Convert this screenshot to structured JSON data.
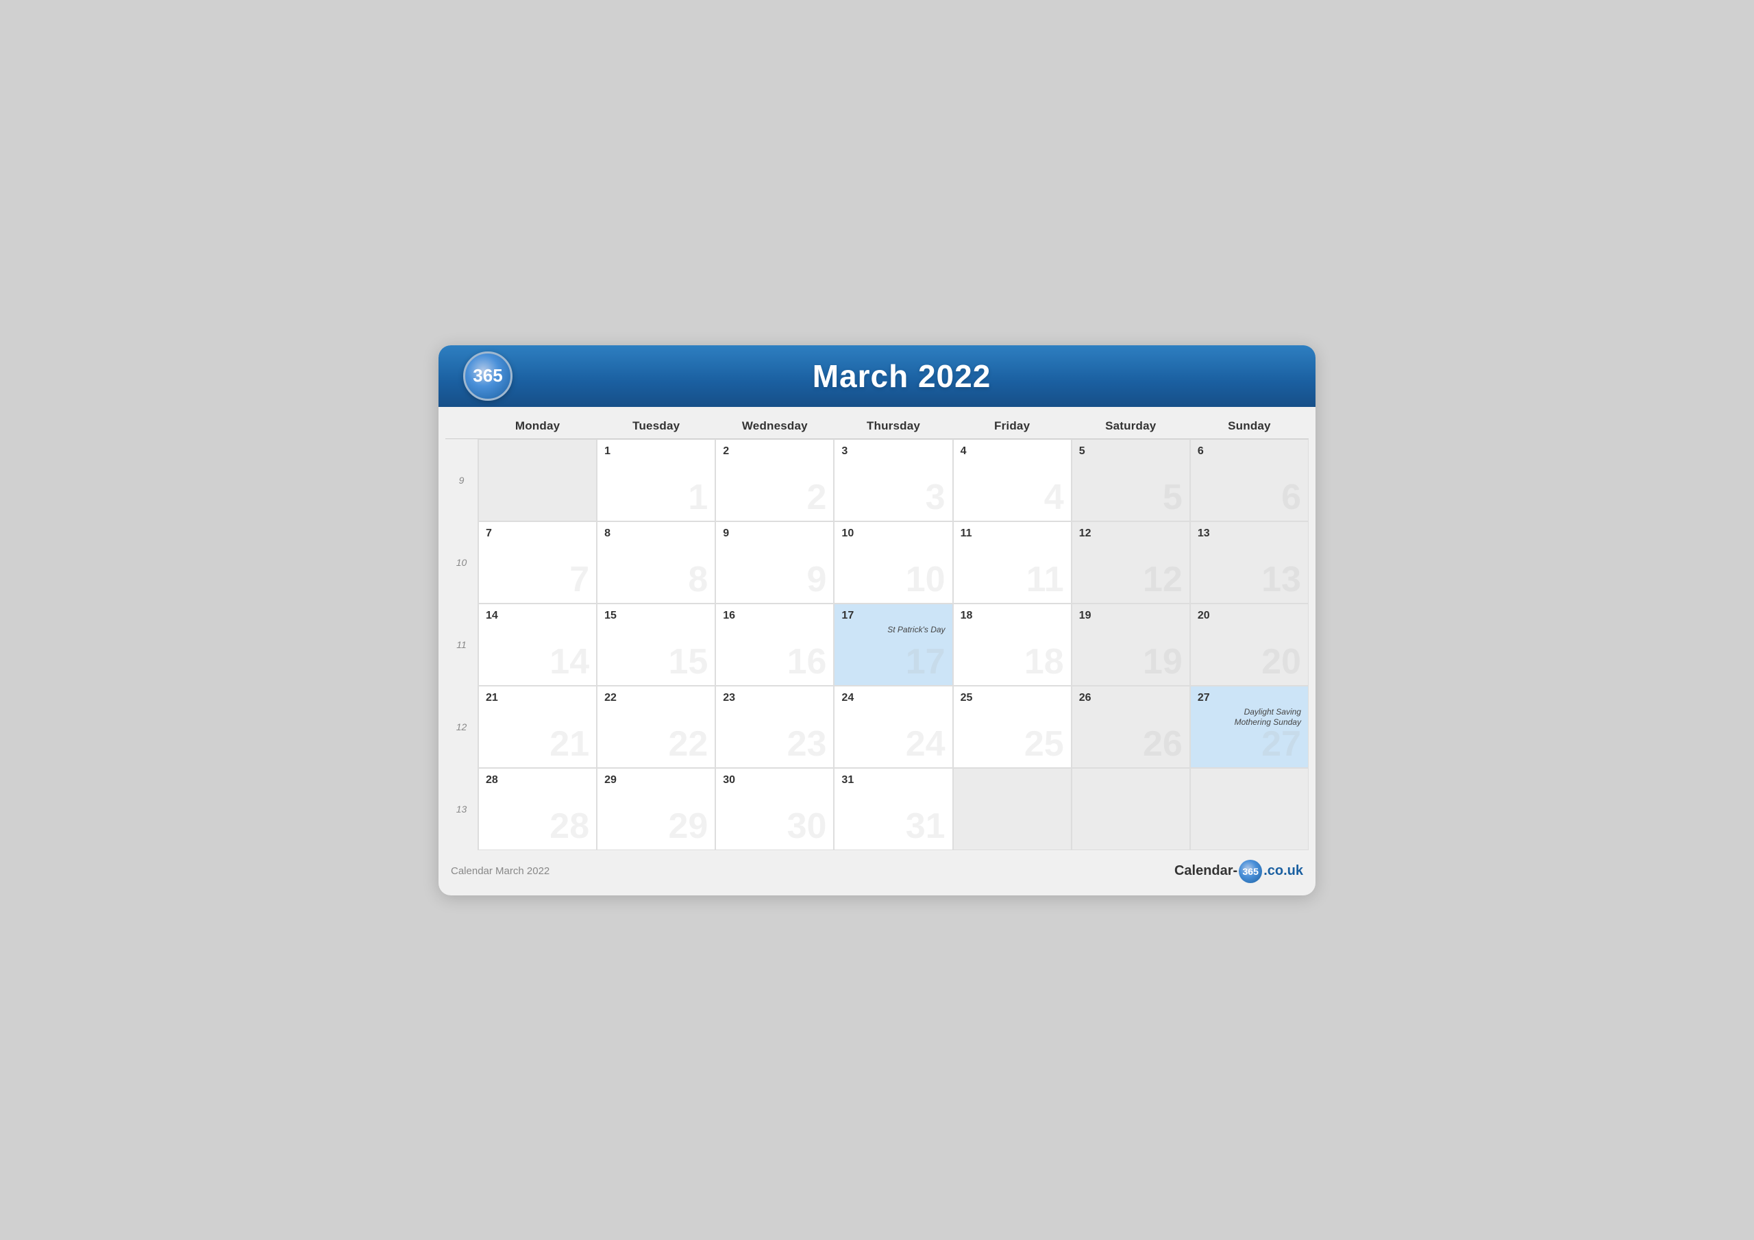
{
  "header": {
    "logo_text": "365",
    "title": "March 2022"
  },
  "footer": {
    "left_label": "Calendar March 2022",
    "brand_pre": "Calendar-",
    "brand_num": "365",
    "brand_post": ".co.uk"
  },
  "days_of_week": [
    "Monday",
    "Tuesday",
    "Wednesday",
    "Thursday",
    "Friday",
    "Saturday",
    "Sunday"
  ],
  "weeks": [
    {
      "week_num": "9",
      "days": [
        {
          "num": "",
          "empty": true
        },
        {
          "num": "1",
          "grey": false,
          "watermark": "1"
        },
        {
          "num": "2",
          "grey": false,
          "watermark": "2"
        },
        {
          "num": "3",
          "grey": false,
          "watermark": "3"
        },
        {
          "num": "4",
          "grey": false,
          "watermark": "4"
        },
        {
          "num": "5",
          "grey": true,
          "watermark": "5"
        },
        {
          "num": "6",
          "grey": true,
          "watermark": "6"
        }
      ]
    },
    {
      "week_num": "10",
      "days": [
        {
          "num": "7",
          "grey": false,
          "watermark": "7"
        },
        {
          "num": "8",
          "grey": false,
          "watermark": "8"
        },
        {
          "num": "9",
          "grey": false,
          "watermark": "9"
        },
        {
          "num": "10",
          "grey": false,
          "watermark": "10"
        },
        {
          "num": "11",
          "grey": false,
          "watermark": "11"
        },
        {
          "num": "12",
          "grey": true,
          "watermark": "12"
        },
        {
          "num": "13",
          "grey": true,
          "watermark": "13"
        }
      ]
    },
    {
      "week_num": "11",
      "days": [
        {
          "num": "14",
          "grey": false,
          "watermark": "14"
        },
        {
          "num": "15",
          "grey": false,
          "watermark": "15"
        },
        {
          "num": "16",
          "grey": false,
          "watermark": "16"
        },
        {
          "num": "17",
          "grey": false,
          "highlight": true,
          "watermark": "17",
          "event": "St Patrick's Day"
        },
        {
          "num": "18",
          "grey": false,
          "watermark": "18"
        },
        {
          "num": "19",
          "grey": true,
          "watermark": "19"
        },
        {
          "num": "20",
          "grey": true,
          "watermark": "20"
        }
      ]
    },
    {
      "week_num": "12",
      "days": [
        {
          "num": "21",
          "grey": false,
          "watermark": "21"
        },
        {
          "num": "22",
          "grey": false,
          "watermark": "22"
        },
        {
          "num": "23",
          "grey": false,
          "watermark": "23"
        },
        {
          "num": "24",
          "grey": false,
          "watermark": "24"
        },
        {
          "num": "25",
          "grey": false,
          "watermark": "25"
        },
        {
          "num": "26",
          "grey": true,
          "watermark": "26"
        },
        {
          "num": "27",
          "grey": false,
          "highlight": true,
          "watermark": "27",
          "event": "Daylight Saving\nMothering Sunday"
        }
      ]
    },
    {
      "week_num": "13",
      "days": [
        {
          "num": "28",
          "grey": false,
          "watermark": "28"
        },
        {
          "num": "29",
          "grey": false,
          "watermark": "29"
        },
        {
          "num": "30",
          "grey": false,
          "watermark": "30"
        },
        {
          "num": "31",
          "grey": false,
          "watermark": "31"
        },
        {
          "num": "",
          "empty": true
        },
        {
          "num": "",
          "empty": true
        },
        {
          "num": "",
          "empty": true
        }
      ]
    }
  ]
}
